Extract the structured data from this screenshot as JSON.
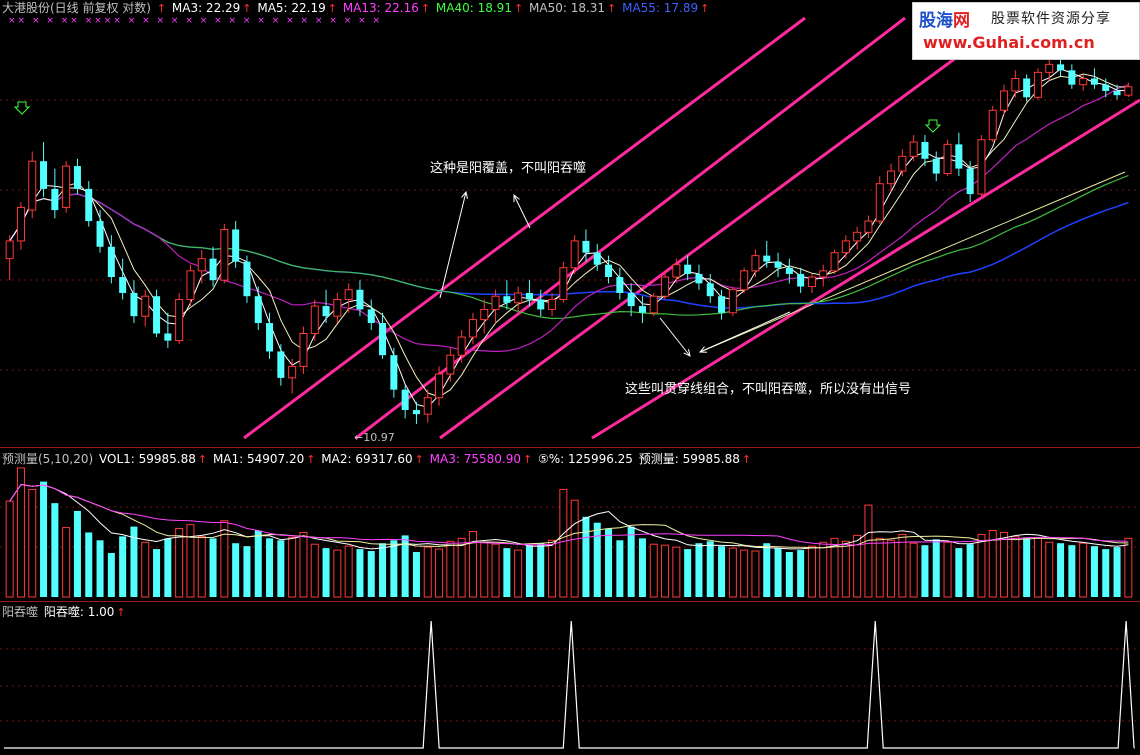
{
  "main_header": {
    "title": "大港股份(日线 前复权 对数)",
    "items": [
      {
        "label": "MA3: 22.29",
        "color": "#ffffff"
      },
      {
        "label": "MA5: 22.19",
        "color": "#ffffff"
      },
      {
        "label": "MA13: 22.16",
        "color": "#ff40ff"
      },
      {
        "label": "MA40: 18.91",
        "color": "#40ff40"
      },
      {
        "label": "MA50: 18.31",
        "color": "#c0c0c0"
      },
      {
        "label": "MA55: 17.89",
        "color": "#4060ff"
      }
    ]
  },
  "vol_header": {
    "title": "预测量(5,10,20)",
    "items": [
      {
        "label": "VOL1: 59985.88",
        "color": "#ffffff"
      },
      {
        "label": "MA1: 54907.20",
        "color": "#ffffff"
      },
      {
        "label": "MA2: 69317.60",
        "color": "#ffffff"
      },
      {
        "label": "MA3: 75580.90",
        "color": "#ff40ff"
      },
      {
        "label": "⑤%: 125996.25",
        "color": "#ffffff"
      },
      {
        "label": "预测量: 59985.88",
        "color": "#ffffff"
      }
    ]
  },
  "sig_header": {
    "title": "阳吞噬",
    "items": [
      {
        "label": "阳吞噬: 1.00",
        "color": "#ffffff"
      }
    ]
  },
  "annotations": {
    "top": "这种是阳覆盖，不叫阳吞噬",
    "bottom": "这些叫贯穿线组合，不叫阳吞噬，所以没有出信号"
  },
  "low_label": "←10.97",
  "logo": {
    "brand_a": "股海",
    "brand_b": "网",
    "slogan": "股票软件资源分享",
    "url": "www.Guhai.com.cn"
  },
  "colors": {
    "bull": "#ff3838",
    "bear": "#54ffff",
    "channel": "#ff2aa0",
    "ma13": "#c020c0",
    "ma40": "#40c040",
    "ma55": "#2040ff",
    "panel_border": "#a01818"
  },
  "chart_data": {
    "type": "candlestick",
    "price_scale": "log",
    "low_marker": 10.97,
    "candles": [
      [
        15.6,
        16.4,
        14.9,
        16.2
      ],
      [
        16.2,
        17.6,
        15.9,
        17.4
      ],
      [
        17.3,
        19.6,
        17.0,
        19.2
      ],
      [
        19.2,
        20.0,
        17.8,
        18.1
      ],
      [
        18.1,
        18.9,
        17.0,
        17.3
      ],
      [
        17.4,
        19.2,
        17.2,
        19.0
      ],
      [
        19.0,
        19.3,
        17.9,
        18.1
      ],
      [
        18.1,
        18.4,
        16.7,
        16.9
      ],
      [
        16.9,
        17.3,
        15.8,
        16.0
      ],
      [
        16.0,
        16.4,
        14.8,
        15.0
      ],
      [
        15.0,
        15.6,
        14.3,
        14.5
      ],
      [
        14.5,
        14.9,
        13.6,
        13.8
      ],
      [
        13.8,
        14.6,
        13.5,
        14.4
      ],
      [
        14.4,
        14.6,
        13.2,
        13.3
      ],
      [
        13.3,
        13.9,
        12.9,
        13.1
      ],
      [
        13.1,
        14.5,
        13.0,
        14.3
      ],
      [
        14.3,
        15.4,
        14.1,
        15.2
      ],
      [
        15.2,
        15.9,
        14.8,
        15.6
      ],
      [
        15.6,
        16.0,
        14.7,
        14.9
      ],
      [
        14.9,
        16.8,
        14.8,
        16.6
      ],
      [
        16.6,
        16.9,
        15.3,
        15.5
      ],
      [
        15.5,
        15.7,
        14.2,
        14.4
      ],
      [
        14.4,
        14.7,
        13.4,
        13.6
      ],
      [
        13.6,
        13.9,
        12.6,
        12.8
      ],
      [
        12.8,
        13.0,
        11.9,
        12.1
      ],
      [
        12.1,
        12.6,
        11.7,
        12.4
      ],
      [
        12.4,
        13.5,
        12.2,
        13.3
      ],
      [
        13.3,
        14.3,
        13.1,
        14.1
      ],
      [
        14.1,
        14.6,
        13.6,
        13.8
      ],
      [
        13.8,
        14.5,
        13.6,
        14.3
      ],
      [
        14.3,
        14.8,
        13.9,
        14.6
      ],
      [
        14.6,
        14.9,
        13.8,
        14.0
      ],
      [
        14.0,
        14.3,
        13.4,
        13.6
      ],
      [
        13.6,
        13.9,
        12.6,
        12.7
      ],
      [
        12.7,
        12.9,
        11.6,
        11.8
      ],
      [
        11.8,
        11.9,
        11.1,
        11.3
      ],
      [
        11.3,
        11.5,
        10.97,
        11.2
      ],
      [
        11.2,
        11.8,
        11.0,
        11.6
      ],
      [
        11.6,
        12.4,
        11.4,
        12.2
      ],
      [
        12.2,
        12.9,
        12.0,
        12.7
      ],
      [
        12.7,
        13.4,
        12.5,
        13.2
      ],
      [
        13.2,
        13.9,
        13.0,
        13.7
      ],
      [
        13.7,
        14.3,
        13.3,
        14.0
      ],
      [
        14.0,
        14.6,
        13.6,
        14.4
      ],
      [
        14.4,
        14.9,
        14.0,
        14.2
      ],
      [
        14.2,
        14.7,
        13.9,
        14.5
      ],
      [
        14.5,
        14.9,
        14.1,
        14.3
      ],
      [
        14.3,
        14.6,
        13.8,
        14.0
      ],
      [
        14.0,
        14.5,
        13.8,
        14.3
      ],
      [
        14.3,
        15.5,
        14.2,
        15.3
      ],
      [
        15.3,
        16.4,
        15.1,
        16.2
      ],
      [
        16.2,
        16.6,
        15.5,
        15.8
      ],
      [
        15.8,
        16.1,
        15.2,
        15.4
      ],
      [
        15.4,
        15.7,
        14.8,
        15.0
      ],
      [
        15.0,
        15.3,
        14.3,
        14.5
      ],
      [
        14.5,
        14.8,
        13.8,
        14.1
      ],
      [
        14.1,
        14.4,
        13.6,
        13.9
      ],
      [
        13.9,
        14.5,
        13.8,
        14.4
      ],
      [
        14.4,
        15.2,
        14.3,
        15.0
      ],
      [
        15.0,
        15.6,
        14.8,
        15.4
      ],
      [
        15.4,
        15.7,
        14.9,
        15.1
      ],
      [
        15.1,
        15.4,
        14.6,
        14.8
      ],
      [
        14.8,
        15.1,
        14.2,
        14.4
      ],
      [
        14.4,
        14.6,
        13.7,
        13.9
      ],
      [
        13.9,
        14.7,
        13.8,
        14.6
      ],
      [
        14.6,
        15.3,
        14.5,
        15.2
      ],
      [
        15.2,
        15.9,
        15.0,
        15.7
      ],
      [
        15.7,
        16.2,
        15.3,
        15.5
      ],
      [
        15.5,
        15.8,
        15.0,
        15.3
      ],
      [
        15.3,
        15.6,
        14.8,
        15.1
      ],
      [
        15.1,
        15.3,
        14.5,
        14.7
      ],
      [
        14.7,
        15.1,
        14.5,
        15.0
      ],
      [
        15.0,
        15.4,
        14.7,
        15.2
      ],
      [
        15.2,
        15.9,
        15.1,
        15.8
      ],
      [
        15.8,
        16.4,
        15.6,
        16.2
      ],
      [
        16.2,
        16.7,
        15.9,
        16.5
      ],
      [
        16.5,
        17.1,
        16.3,
        16.9
      ],
      [
        16.9,
        18.6,
        16.8,
        18.3
      ],
      [
        18.3,
        19.1,
        18.0,
        18.8
      ],
      [
        18.8,
        19.7,
        18.6,
        19.4
      ],
      [
        19.4,
        20.3,
        19.2,
        20.0
      ],
      [
        20.0,
        20.3,
        19.0,
        19.3
      ],
      [
        19.3,
        19.6,
        18.4,
        18.7
      ],
      [
        18.7,
        20.1,
        18.6,
        19.9
      ],
      [
        19.9,
        20.4,
        18.6,
        18.9
      ],
      [
        18.9,
        19.2,
        17.6,
        17.9
      ],
      [
        17.9,
        20.3,
        17.8,
        20.1
      ],
      [
        20.1,
        21.6,
        20.0,
        21.4
      ],
      [
        21.4,
        22.6,
        21.2,
        22.3
      ],
      [
        22.3,
        23.3,
        22.0,
        22.9
      ],
      [
        22.9,
        23.1,
        21.8,
        22.0
      ],
      [
        22.0,
        23.4,
        21.9,
        23.2
      ],
      [
        23.2,
        24.0,
        22.8,
        23.6
      ],
      [
        23.6,
        24.2,
        23.0,
        23.3
      ],
      [
        23.3,
        23.6,
        22.4,
        22.6
      ],
      [
        22.6,
        23.1,
        22.3,
        22.9
      ],
      [
        22.9,
        23.4,
        22.4,
        22.6
      ],
      [
        22.6,
        22.9,
        22.0,
        22.3
      ],
      [
        22.3,
        22.6,
        21.9,
        22.1
      ],
      [
        22.1,
        22.7,
        22.0,
        22.5
      ]
    ],
    "volume": [
      98000,
      132000,
      110000,
      118000,
      96000,
      71000,
      88000,
      66000,
      58000,
      45000,
      62000,
      72000,
      56000,
      49000,
      60000,
      70000,
      74000,
      62000,
      60000,
      78000,
      55000,
      52000,
      68000,
      60000,
      58000,
      61000,
      66000,
      54000,
      50000,
      48000,
      52000,
      49000,
      47000,
      55000,
      58000,
      63000,
      46000,
      51000,
      49000,
      57000,
      60000,
      67000,
      56000,
      54000,
      50000,
      48000,
      53000,
      55000,
      58000,
      110000,
      99000,
      82000,
      76000,
      70000,
      58000,
      72000,
      60000,
      54000,
      53000,
      51000,
      49000,
      55000,
      57000,
      52000,
      50000,
      48000,
      47000,
      55000,
      50000,
      46000,
      48000,
      52000,
      56000,
      60000,
      57000,
      63000,
      94000,
      60000,
      58000,
      64000,
      55000,
      53000,
      59000,
      56000,
      50000,
      54000,
      64000,
      68000,
      66000,
      62000,
      61000,
      60000,
      56000,
      55000,
      53000,
      55000,
      52000,
      49000,
      51000,
      59986
    ],
    "signal": [
      {
        "index": 0.378,
        "value": 1.0
      },
      {
        "index": 0.502,
        "value": 1.0
      },
      {
        "index": 0.771,
        "value": 1.0
      },
      {
        "index": 0.993,
        "value": 1.0
      }
    ]
  }
}
